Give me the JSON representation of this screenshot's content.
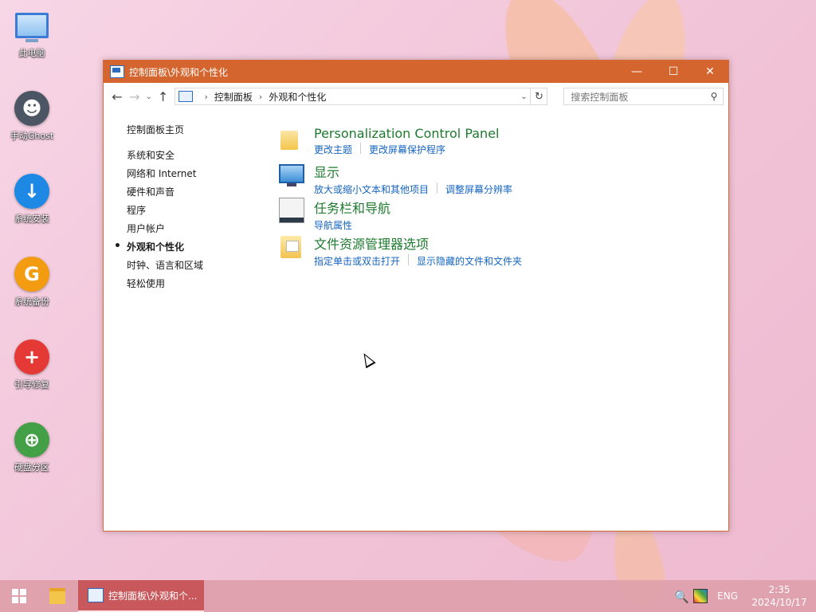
{
  "desktop": {
    "icons": [
      {
        "label": "此电脑",
        "icon": "computer-icon"
      },
      {
        "label": "手动Ghost",
        "icon": "ghost-icon"
      },
      {
        "label": "系统安装",
        "icon": "install-arrow-icon"
      },
      {
        "label": "系统备份",
        "icon": "backup-g-icon"
      },
      {
        "label": "引导修复",
        "icon": "repair-plus-icon"
      },
      {
        "label": "硬盘分区",
        "icon": "partition-icon"
      }
    ]
  },
  "window": {
    "title": "控制面板\\外观和个性化",
    "controls": {
      "minimize": "—",
      "maximize": "☐",
      "close": "✕"
    },
    "nav": {
      "back": "←",
      "forward": "→",
      "recent": "⌄",
      "up": "↑",
      "refresh": "↻"
    },
    "breadcrumb": [
      "控制面板",
      "外观和个性化"
    ],
    "search_placeholder": "搜索控制面板",
    "colors": {
      "titlebar": "#d5652e",
      "link": "#1565c0",
      "category_title": "#1e7a2e"
    }
  },
  "sidebar": {
    "home": "控制面板主页",
    "items": [
      {
        "label": "系统和安全",
        "active": false
      },
      {
        "label": "网络和 Internet",
        "active": false
      },
      {
        "label": "硬件和声音",
        "active": false
      },
      {
        "label": "程序",
        "active": false
      },
      {
        "label": "用户帐户",
        "active": false
      },
      {
        "label": "外观和个性化",
        "active": true
      },
      {
        "label": "时钟、语言和区域",
        "active": false
      },
      {
        "label": "轻松使用",
        "active": false
      }
    ]
  },
  "categories": [
    {
      "title": "Personalization Control Panel",
      "icon": "folder-icon",
      "links": [
        "更改主题",
        "更改屏幕保护程序"
      ]
    },
    {
      "title": "显示",
      "icon": "display-icon",
      "links": [
        "放大或缩小文本和其他项目",
        "调整屏幕分辨率"
      ]
    },
    {
      "title": "任务栏和导航",
      "icon": "taskbar-icon",
      "links": [
        "导航属性"
      ]
    },
    {
      "title": "文件资源管理器选项",
      "icon": "folder-options-icon",
      "links": [
        "指定单击或双击打开",
        "显示隐藏的文件和文件夹"
      ]
    }
  ],
  "taskbar": {
    "active_app": "控制面板\\外观和个...",
    "language": "ENG",
    "time": "2:35",
    "date": "2024/10/17"
  }
}
